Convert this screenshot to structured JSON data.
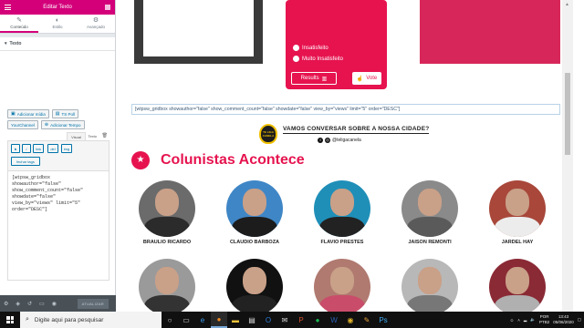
{
  "editor": {
    "title": "Editar Texto",
    "tabs": [
      {
        "label": "Conteúdo",
        "icon": "pencil-icon"
      },
      {
        "label": "Estilo",
        "icon": "brush-icon"
      },
      {
        "label": "Avançado",
        "icon": "gear-icon"
      }
    ],
    "section": "Texto",
    "media_buttons": [
      "Adicionar mídia",
      "TS Poll",
      "YourChannel",
      "Adicionar Tempo"
    ],
    "mode_tabs": {
      "visual": "Visual",
      "text": "Texto"
    },
    "quicktags": [
      "b",
      "i",
      "link",
      "del",
      "img",
      "fechar tags"
    ],
    "code": "[wtpsw_gridbox\nshowauthor=\"false\"\nshow_comment_count=\"false\"\nshowdate=\"false\"\nview_by=\"views\" limit=\"5\"\norder=\"DESC\"]",
    "update_label": "ATUALIZAR"
  },
  "poll": {
    "options": [
      "Insatisfeito",
      "Muito Insatisfeito"
    ],
    "results_label": "Results",
    "vote_label": "Vote"
  },
  "shortcode_text": "[wtpsw_gridbox showauthor=\"false\" show_comment_count=\"false\" showdate=\"false\" view_by=\"views\" limit=\"5\" order=\"DESC\"]",
  "banner": {
    "badge": "TE LIGA CANELA",
    "headline": "VAMOS CONVERSAR SOBRE A NOSSA CIDADE?",
    "handle": "@teligacanela"
  },
  "section_title": "Colunistas Acontece",
  "columnists": [
    {
      "name": "BRAULIO RICARDO",
      "bg": "#6b6b6b",
      "shirt": "#2b2b2b"
    },
    {
      "name": "CLAUDIO BARBOZA",
      "bg": "#3f86c6",
      "shirt": "#1c1c1c"
    },
    {
      "name": "FLAVIO PRESTES",
      "bg": "#1f8fb8",
      "shirt": "#222222"
    },
    {
      "name": "JAISON REMONTI",
      "bg": "#8a8a8a",
      "shirt": "#5a5a5a"
    },
    {
      "name": "JARDEL HAY",
      "bg": "#a8473a",
      "shirt": "#ececec"
    },
    {
      "name": "",
      "bg": "#9a9a9a",
      "shirt": "#333333"
    },
    {
      "name": "",
      "bg": "#111111",
      "shirt": "#222222"
    },
    {
      "name": "",
      "bg": "#b07a70",
      "shirt": "#c94d6a"
    },
    {
      "name": "",
      "bg": "#b8b8b8",
      "shirt": "#777777"
    },
    {
      "name": "",
      "bg": "#8a2a35",
      "shirt": "#b0b0b0"
    }
  ],
  "taskbar": {
    "search_placeholder": "Digite aqui para pesquisar",
    "language": "POR",
    "layout": "PTB2",
    "time": "13:43",
    "date": "05/06/2020"
  },
  "colors": {
    "accent": "#d3007a",
    "poll": "#e6134f",
    "brand_pink": "#e6134f"
  }
}
